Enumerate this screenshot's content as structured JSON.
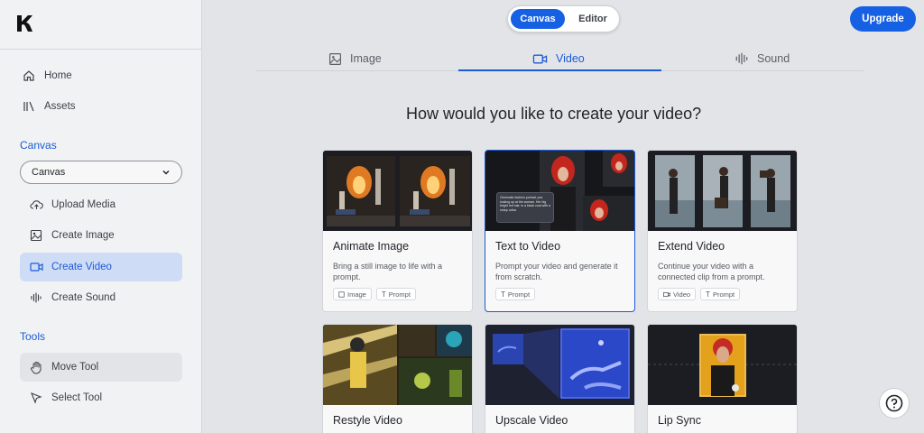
{
  "toggle": {
    "canvas": "Canvas",
    "editor": "Editor"
  },
  "upgrade": "Upgrade",
  "sidebar": {
    "home": "Home",
    "assets": "Assets",
    "canvas_section": "Canvas",
    "canvas_select": "Canvas",
    "upload_media": "Upload Media",
    "create_image": "Create Image",
    "create_video": "Create Video",
    "create_sound": "Create Sound",
    "tools_section": "Tools",
    "move_tool": "Move Tool",
    "select_tool": "Select Tool"
  },
  "tabs": {
    "image": "Image",
    "video": "Video",
    "sound": "Sound"
  },
  "heading": "How would you like to create your video?",
  "cards": [
    {
      "title": "Animate Image",
      "desc": "Bring a still image to life with a prompt.",
      "chips": [
        "Image",
        "Prompt"
      ]
    },
    {
      "title": "Text to Video",
      "desc": "Prompt your video and generate it from scratch.",
      "chips": [
        "Prompt"
      ],
      "overlay": "Cinematic fashion portrait, pov looking up at the woman. Her big bright red hair, in a black coat with a sharp collar."
    },
    {
      "title": "Extend Video",
      "desc": "Continue your video with a connected clip from a prompt.",
      "chips": [
        "Video",
        "Prompt"
      ]
    },
    {
      "title": "Restyle Video"
    },
    {
      "title": "Upscale Video"
    },
    {
      "title": "Lip Sync"
    }
  ],
  "colors": {
    "accent": "#1660e4",
    "active_bg": "#cfdcf6"
  }
}
